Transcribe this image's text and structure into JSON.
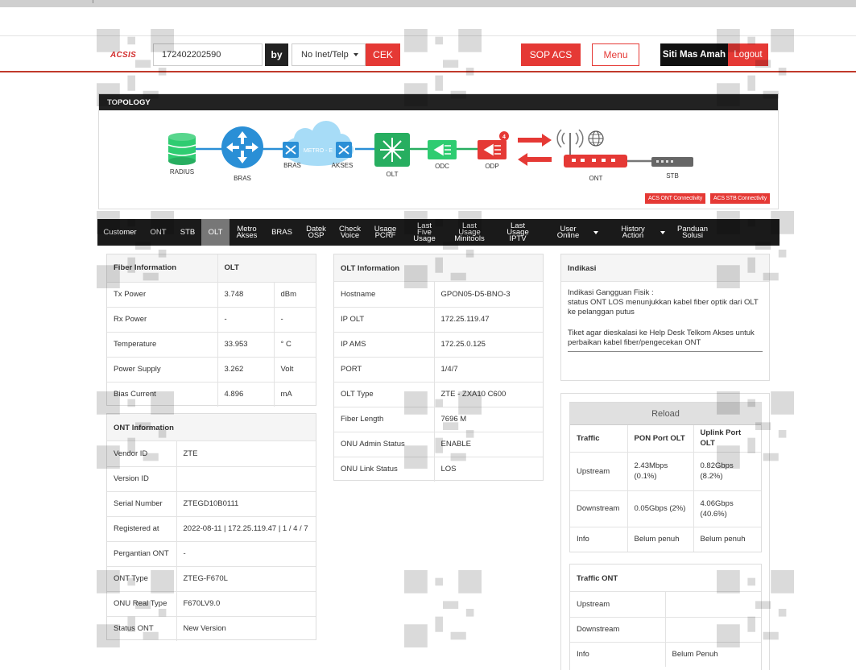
{
  "header": {
    "logo": "ACSIS",
    "search_value": "172402202590",
    "by_label": "by",
    "search_mode": "No Inet/Telp",
    "cek_label": "CEK",
    "sop_label": "SOP ACS",
    "menu_label": "Menu",
    "user_name": "Siti Mas Amah",
    "logout_label": "Logout"
  },
  "topology": {
    "title": "TOPOLOGY",
    "nodes": {
      "radius": "RADIUS",
      "bras": "BRAS",
      "metro_bras": "BRAS",
      "metro_cloud": "METRO - E",
      "metro_akses": "AKSES",
      "olt": "OLT",
      "odc": "ODC",
      "odp": "ODP",
      "odp_badge": "4",
      "ont": "ONT",
      "stb": "STB"
    },
    "buttons": {
      "acs_ont": "ACS ONT Connectivity",
      "acs_stb": "ACS STB Connectivity"
    },
    "colors": {
      "accent": "#e53935",
      "bras": "#2a8fd6",
      "green": "#27ae60"
    }
  },
  "tabs": [
    {
      "l1": "Customer",
      "l2": ""
    },
    {
      "l1": "ONT",
      "l2": ""
    },
    {
      "l1": "STB",
      "l2": ""
    },
    {
      "l1": "OLT",
      "l2": ""
    },
    {
      "l1": "Metro",
      "l2": "Akses"
    },
    {
      "l1": "BRAS",
      "l2": ""
    },
    {
      "l1": "Datek",
      "l2": "OSP"
    },
    {
      "l1": "Check",
      "l2": "Voice"
    },
    {
      "l1": "Usage",
      "l2": "PCRF"
    },
    {
      "l1": "Last Five",
      "l2": "Usage"
    },
    {
      "l1": "Last Usage",
      "l2": "Minitools"
    },
    {
      "l1": "Last Usage",
      "l2": "IPTV"
    },
    {
      "l1": "User Online",
      "l2": ""
    },
    {
      "l1": "History Action",
      "l2": ""
    },
    {
      "l1": "Panduan",
      "l2": "Solusi"
    }
  ],
  "fiber": {
    "title": "Fiber Information",
    "title_value": "OLT",
    "rows": [
      {
        "label": "Tx Power",
        "value": "3.748",
        "unit": "dBm"
      },
      {
        "label": "Rx Power",
        "value": "-",
        "unit": "-"
      },
      {
        "label": "Temperature",
        "value": "33.953",
        "unit": "° C"
      },
      {
        "label": "Power Supply",
        "value": "3.262",
        "unit": "Volt"
      },
      {
        "label": "Bias Current",
        "value": "4.896",
        "unit": "mA"
      }
    ]
  },
  "ont_info": {
    "title": "ONT Information",
    "rows": [
      {
        "label": "Vendor ID",
        "value": "ZTE"
      },
      {
        "label": "Version ID",
        "value": ""
      },
      {
        "label": "Serial Number",
        "value": "ZTEGD10B0111"
      },
      {
        "label": "Registered at",
        "value": "2022-08-11 | 172.25.119.47 | 1 / 4 / 7"
      },
      {
        "label": "Pergantian ONT",
        "value": "-"
      },
      {
        "label": "ONT Type",
        "value": "ZTEG-F670L"
      },
      {
        "label": "ONU Real Type",
        "value": "F670LV9.0"
      },
      {
        "label": "Status ONT",
        "value": "New Version"
      }
    ]
  },
  "olt_info": {
    "title": "OLT Information",
    "rows": [
      {
        "label": "Hostname",
        "value": "GPON05-D5-BNO-3"
      },
      {
        "label": "IP OLT",
        "value": "172.25.119.47"
      },
      {
        "label": "IP AMS",
        "value": "172.25.0.125"
      },
      {
        "label": "PORT",
        "value": "1/4/7"
      },
      {
        "label": "OLT Type",
        "value": "ZTE - ZXA10 C600"
      },
      {
        "label": "Fiber Length",
        "value": "7696 M"
      },
      {
        "label": "ONU Admin Status",
        "value": "ENABLE"
      },
      {
        "label": "ONU Link Status",
        "value": "LOS"
      }
    ]
  },
  "indikasi": {
    "title": "Indikasi",
    "line1": "Indikasi Gangguan Fisik :",
    "line2": "status ONT LOS menunjukkan kabel fiber optik dari OLT ke pelanggan putus",
    "line3": "Tiket agar dieskalasi ke Help Desk Telkom Akses untuk perbaikan kabel fiber/pengecekan ONT"
  },
  "traffic": {
    "reload_label": "Reload",
    "headers": [
      "Traffic",
      "PON Port OLT",
      "Uplink Port OLT"
    ],
    "rows": [
      {
        "label": "Upstream",
        "pon": "2.43Mbps (0.1%)",
        "uplink": "0.82Gbps (8.2%)"
      },
      {
        "label": "Downstream",
        "pon": "0.05Gbps (2%)",
        "uplink": "4.06Gbps (40.6%)"
      },
      {
        "label": "Info",
        "pon": "Belum penuh",
        "uplink": "Belum penuh"
      }
    ]
  },
  "traffic_ont": {
    "title": "Traffic ONT",
    "rows": [
      {
        "label": "Upstream",
        "value": ""
      },
      {
        "label": "Downstream",
        "value": ""
      },
      {
        "label": "Info",
        "value": "Belum Penuh"
      }
    ]
  }
}
